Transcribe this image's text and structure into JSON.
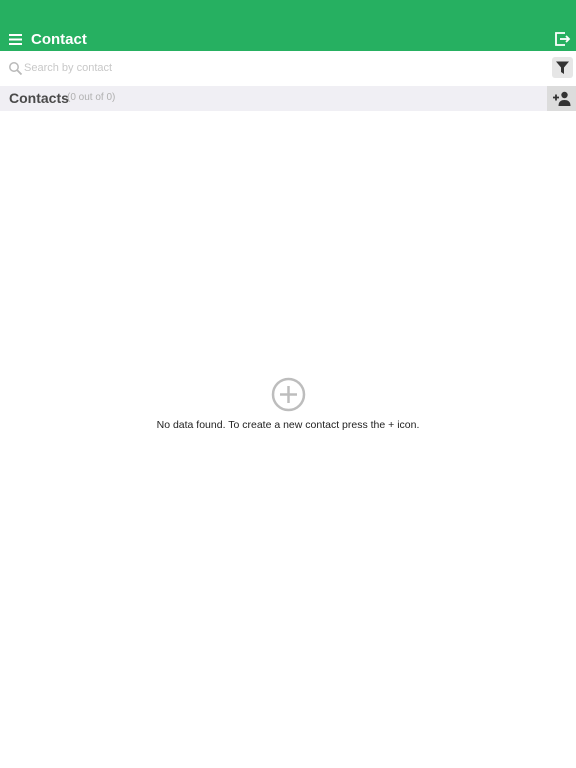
{
  "header": {
    "title": "Contact",
    "menu_icon": "hamburger-menu-icon",
    "logout_icon": "exit-icon",
    "color": "#26b061"
  },
  "search": {
    "placeholder": "Search by contact",
    "value": "",
    "filter_icon": "filter-icon"
  },
  "section": {
    "title": "Contacts",
    "count": "(0 out of 0)",
    "add_icon": "add-person-icon"
  },
  "empty": {
    "icon": "plus-circle-icon",
    "message": "No data found. To create a new contact press the + icon."
  }
}
